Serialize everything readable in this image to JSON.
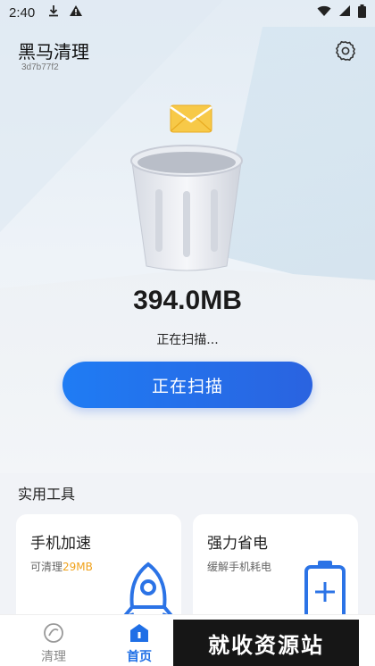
{
  "status_bar": {
    "time": "2:40",
    "icons": [
      "download-icon",
      "warning-icon",
      "wifi-icon",
      "signal-icon",
      "battery-icon"
    ]
  },
  "header": {
    "title": "黑马清理",
    "subtitle": "3d7b77f2",
    "settings_icon": "gear-icon"
  },
  "scan": {
    "size": "394.0MB",
    "status": "正在扫描...",
    "button_label": "正在扫描"
  },
  "tools": {
    "section_title": "实用工具",
    "items": [
      {
        "title": "手机加速",
        "desc_prefix": "可清理",
        "desc_highlight": "29MB",
        "icon": "rocket-icon"
      },
      {
        "title": "强力省电",
        "desc": "缓解手机耗电",
        "icon": "battery-plus-icon"
      }
    ]
  },
  "bottom_nav": {
    "items": [
      {
        "label": "清理",
        "icon": "clean-icon",
        "active": false
      },
      {
        "label": "首页",
        "icon": "home-icon",
        "active": true
      }
    ]
  },
  "watermark": "就收资源站",
  "colors": {
    "accent": "#1f7cf4",
    "highlight": "#f0a21b"
  }
}
